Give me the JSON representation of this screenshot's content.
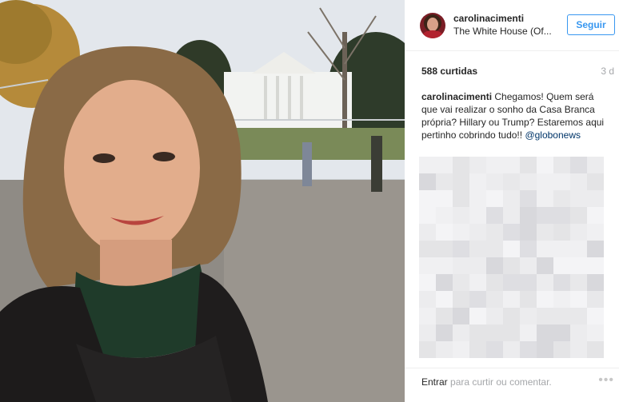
{
  "post": {
    "username": "carolinacimenti",
    "location": "The White House (Of...",
    "follow_label": "Seguir",
    "likes": "588 curtidas",
    "time_ago": "3 d",
    "caption": {
      "author": "carolinacimenti",
      "text": "Chegamos! Quem será que vai realizar o sonho da Casa Branca própria? Hillary ou Trump? Estaremos aqui pertinho cobrindo tudo!!",
      "mention": "@globonews"
    },
    "footer": {
      "login_link": "Entrar",
      "login_rest": "para curtir ou comentar.",
      "more": "•••"
    }
  },
  "colors": {
    "accent": "#3897f0",
    "text": "#262626",
    "muted": "#a5a7aa",
    "mention": "#003569",
    "border": "#efefef"
  },
  "icons": {
    "avatar": "profile-avatar",
    "more": "more-options-icon"
  }
}
